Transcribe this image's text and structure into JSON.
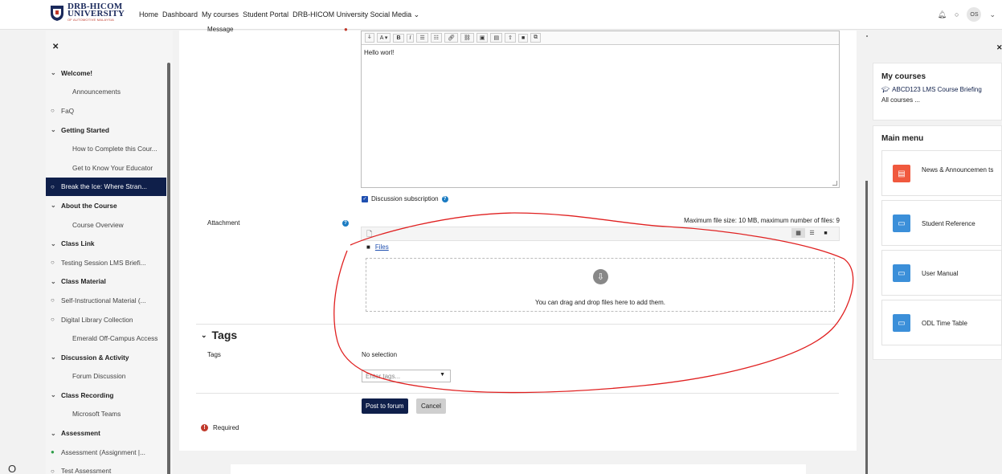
{
  "topnav": {
    "logo_line1": "DRB-HICOM",
    "logo_line2": "UNIVERSITY",
    "logo_line3": "OF AUTOMOTIVE MALAYSIA",
    "links": [
      "Home",
      "Dashboard",
      "My courses",
      "Student Portal",
      "DRB-HICOM University Social Media"
    ],
    "avatar_initials": "OS"
  },
  "leftnav": {
    "items": [
      {
        "label": "Welcome!",
        "kind": "section"
      },
      {
        "label": "Announcements",
        "kind": "sub"
      },
      {
        "label": "FaQ",
        "kind": "circle"
      },
      {
        "label": "Getting Started",
        "kind": "section"
      },
      {
        "label": "How to Complete this Cour...",
        "kind": "sub"
      },
      {
        "label": "Get to Know Your Educator",
        "kind": "sub"
      },
      {
        "label": "Break the Ice: Where Stran...",
        "kind": "active"
      },
      {
        "label": "About the Course",
        "kind": "section"
      },
      {
        "label": "Course Overview",
        "kind": "sub"
      },
      {
        "label": "Class Link",
        "kind": "section"
      },
      {
        "label": "Testing Session LMS Briefi...",
        "kind": "circle"
      },
      {
        "label": "Class Material",
        "kind": "section"
      },
      {
        "label": "Self-Instructional Material (...",
        "kind": "circle"
      },
      {
        "label": "Digital Library Collection",
        "kind": "circle"
      },
      {
        "label": "Emerald Off-Campus Access",
        "kind": "sub"
      },
      {
        "label": "Discussion & Activity",
        "kind": "section"
      },
      {
        "label": "Forum Discussion",
        "kind": "sub"
      },
      {
        "label": "Class Recording",
        "kind": "section"
      },
      {
        "label": "Microsoft Teams",
        "kind": "sub"
      },
      {
        "label": "Assessment",
        "kind": "section"
      },
      {
        "label": "Assessment (Assignment |...",
        "kind": "green"
      },
      {
        "label": "Test Assessment",
        "kind": "circle"
      }
    ]
  },
  "form": {
    "message_label": "Message",
    "message_text": "Hello worl!",
    "subscription_label": "Discussion subscription",
    "attachment_label": "Attachment",
    "max_size_text": "Maximum file size: 10 MB, maximum number of files: 9",
    "files_link": "Files",
    "dropzone_text": "You can drag and drop files here to add them.",
    "tags_section": "Tags",
    "tags_label": "Tags",
    "no_selection": "No selection",
    "tags_placeholder": "Enter tags...",
    "post_button": "Post to forum",
    "cancel_button": "Cancel",
    "required_text": "Required"
  },
  "rightnav": {
    "my_courses_title": "My courses",
    "course_link": "ABCD123 LMS Course Briefing",
    "all_courses": "All courses ...",
    "main_menu_title": "Main menu",
    "menu_items": [
      {
        "label": "News & Announcemen ts",
        "color": "#f0593e"
      },
      {
        "label": "Student Reference",
        "color": "#3b8fd9"
      },
      {
        "label": "User Manual",
        "color": "#3b8fd9"
      },
      {
        "label": "ODL Time Table",
        "color": "#3b8fd9"
      }
    ]
  },
  "bottom_glyph": "O"
}
